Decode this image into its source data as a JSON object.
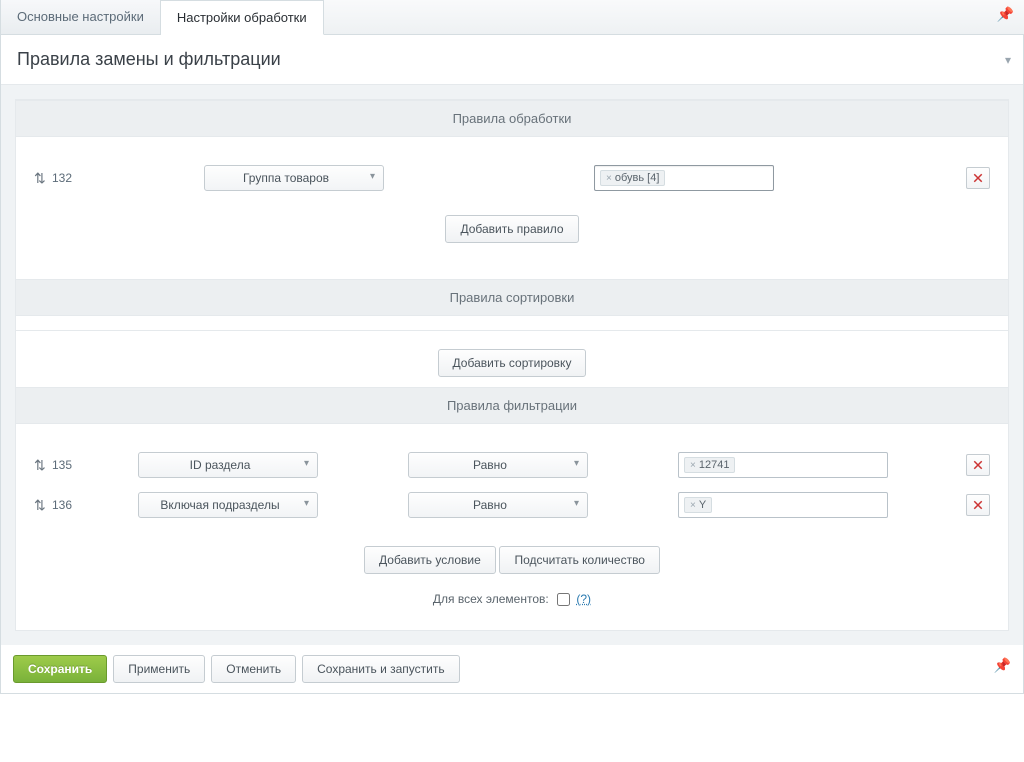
{
  "tabs": {
    "main": "Основные настройки",
    "processing": "Настройки обработки"
  },
  "panel": {
    "title": "Правила замены и фильтрации"
  },
  "sections": {
    "processing_rules": "Правила обработки",
    "sort_rules": "Правила сортировки",
    "filter_rules": "Правила фильтрации"
  },
  "processing_rows": [
    {
      "num": "132",
      "select": "Группа товаров",
      "tags": [
        "обувь [4]"
      ]
    }
  ],
  "filter_rows": [
    {
      "num": "135",
      "field": "ID раздела",
      "op": "Равно",
      "tags": [
        "12741"
      ]
    },
    {
      "num": "136",
      "field": "Включая подразделы",
      "op": "Равно",
      "tags": [
        "Y"
      ]
    }
  ],
  "buttons": {
    "add_rule": "Добавить правило",
    "add_sort": "Добавить сортировку",
    "add_cond": "Добавить условие",
    "count": "Подсчитать количество",
    "save": "Сохранить",
    "apply": "Применить",
    "cancel": "Отменить",
    "save_run": "Сохранить и запустить"
  },
  "all_elements": {
    "label": "Для всех элементов:",
    "hint": "(?)"
  }
}
